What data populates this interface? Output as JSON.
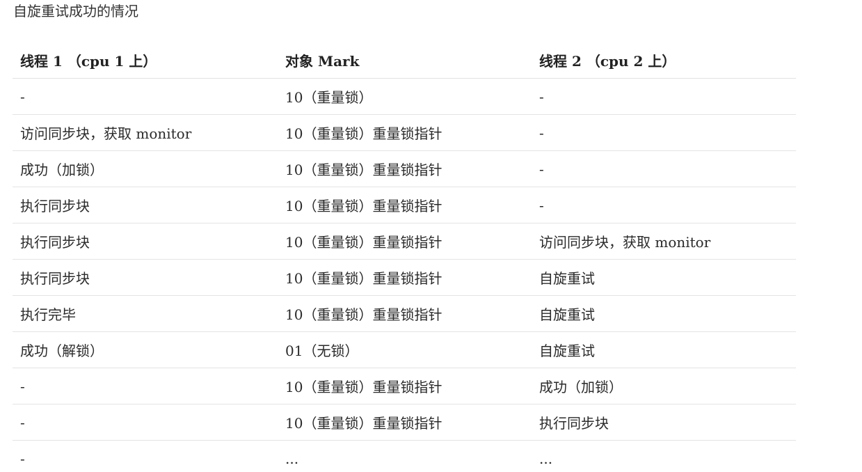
{
  "title": "自旋重试成功的情况",
  "table": {
    "headers": [
      "线程 1 （cpu 1 上）",
      "对象 Mark",
      "线程 2 （cpu 2 上）"
    ],
    "rows": [
      [
        "-",
        "10（重量锁）",
        "-"
      ],
      [
        "访问同步块，获取 monitor",
        "10（重量锁）重量锁指针",
        "-"
      ],
      [
        "成功（加锁）",
        "10（重量锁）重量锁指针",
        "-"
      ],
      [
        "执行同步块",
        "10（重量锁）重量锁指针",
        "-"
      ],
      [
        "执行同步块",
        "10（重量锁）重量锁指针",
        "访问同步块，获取 monitor"
      ],
      [
        "执行同步块",
        "10（重量锁）重量锁指针",
        "自旋重试"
      ],
      [
        "执行完毕",
        "10（重量锁）重量锁指针",
        "自旋重试"
      ],
      [
        "成功（解锁）",
        "01（无锁）",
        "自旋重试"
      ],
      [
        "-",
        "10（重量锁）重量锁指针",
        "成功（加锁）"
      ],
      [
        "-",
        "10（重量锁）重量锁指针",
        "执行同步块"
      ],
      [
        "-",
        "...",
        "..."
      ]
    ]
  }
}
